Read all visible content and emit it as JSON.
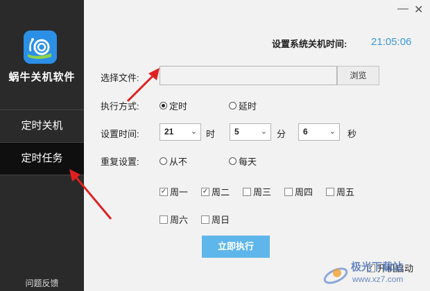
{
  "sidebar": {
    "app_name": "蜗牛关机软件",
    "items": [
      {
        "label": "定时关机"
      },
      {
        "label": "定时任务"
      }
    ],
    "feedback": "问题反馈"
  },
  "window": {
    "minimize": "—",
    "close": "✕"
  },
  "header": {
    "clock_label": "设置系统关机时间:",
    "clock_value": "21:05:06"
  },
  "form": {
    "file_label": "选择文件:",
    "file_value": "",
    "browse_label": "浏览",
    "mode_label": "执行方式:",
    "mode_options": [
      "定时",
      "延时"
    ],
    "mode_selected": "定时",
    "time_label": "设置时间:",
    "hour": "21",
    "hour_unit": "时",
    "minute": "5",
    "minute_unit": "分",
    "second": "6",
    "second_unit": "秒",
    "repeat_label": "重复设置:",
    "repeat_options": [
      "从不",
      "每天"
    ],
    "weekdays": [
      {
        "label": "周一",
        "checked": true
      },
      {
        "label": "周二",
        "checked": true
      },
      {
        "label": "周三",
        "checked": false
      },
      {
        "label": "周四",
        "checked": false
      },
      {
        "label": "周五",
        "checked": false
      },
      {
        "label": "周六",
        "checked": false
      },
      {
        "label": "周日",
        "checked": false
      }
    ],
    "execute_label": "立即执行",
    "autostart_label": "开机启动"
  },
  "watermark": {
    "text": "极光下载站",
    "url": "www.xz7.com"
  },
  "colors": {
    "sidebar": "#2a2a2a",
    "accent": "#5fb6ea",
    "clock": "#3a9ad9",
    "annotation": "#e02020"
  }
}
